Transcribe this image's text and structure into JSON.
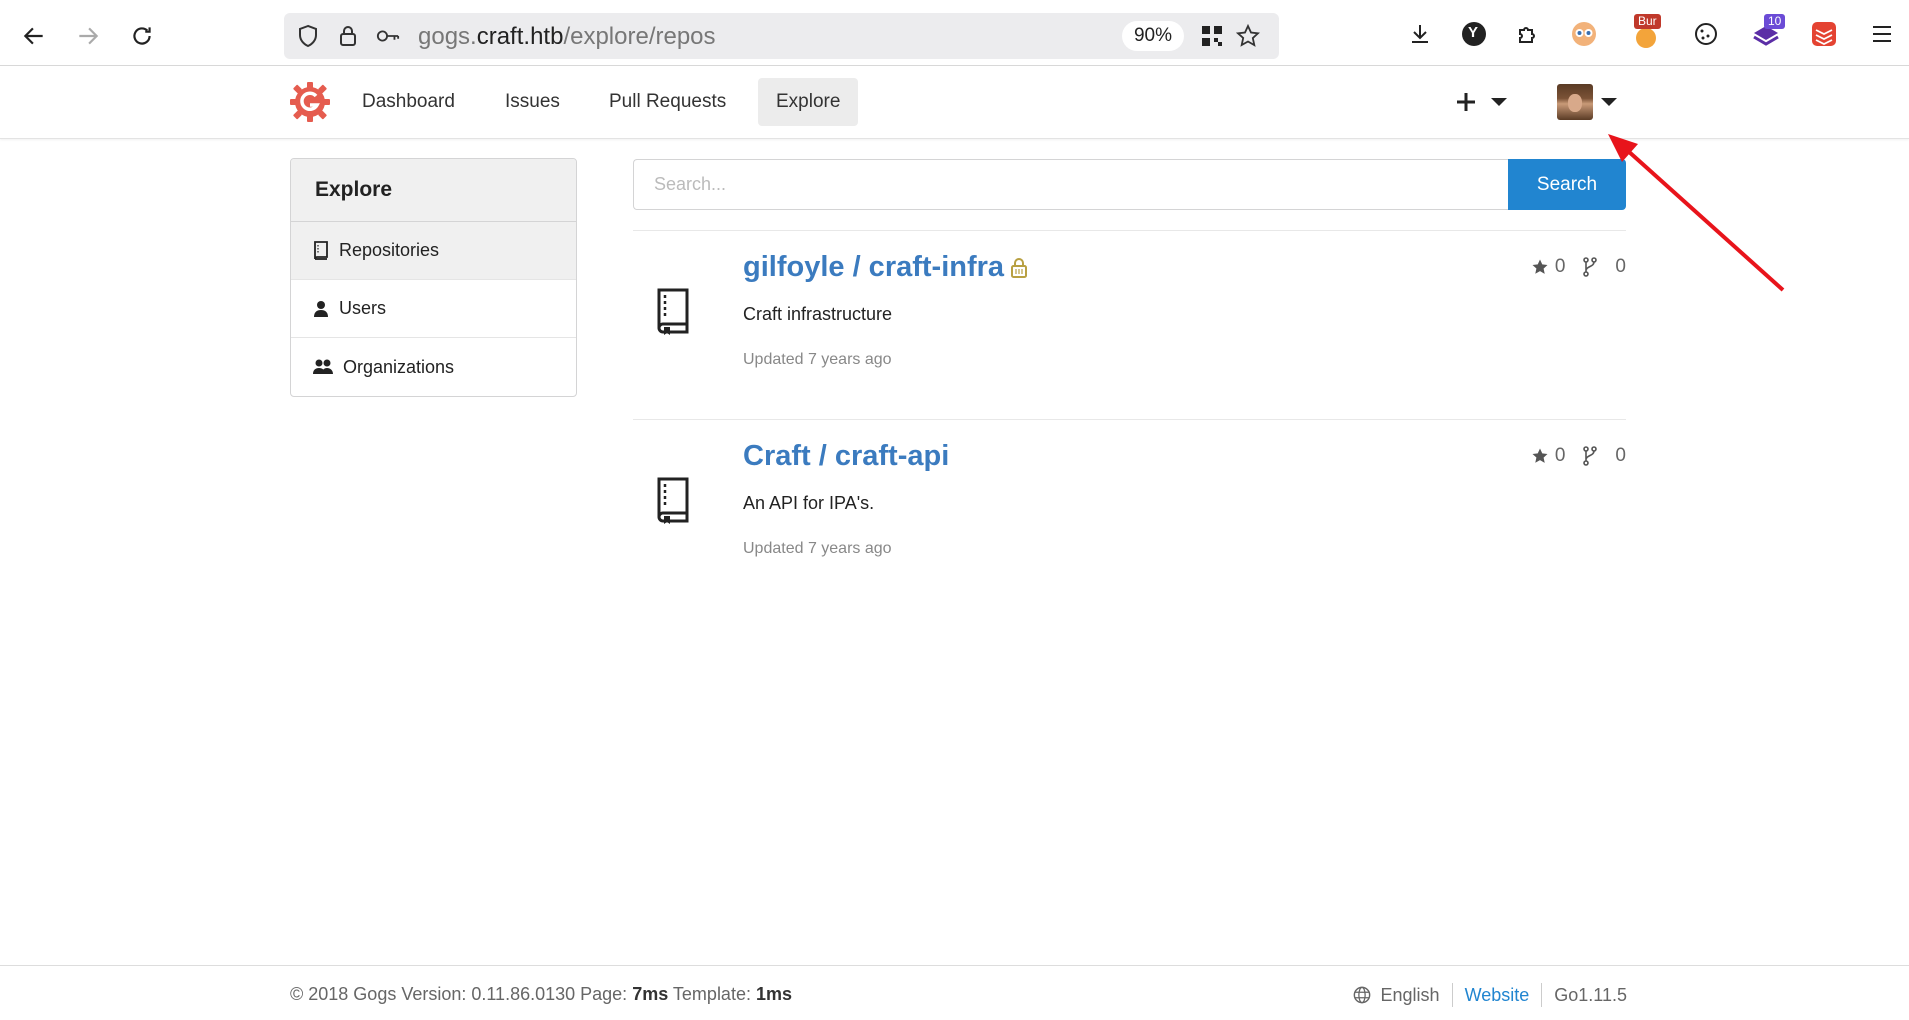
{
  "browser": {
    "url_prefix": "gogs.",
    "url_host": "craft.htb",
    "url_path": "/explore/repos",
    "zoom": "90%",
    "burp_badge": "Bur",
    "ext_count_badge": "10",
    "yandex_label": "Y"
  },
  "header": {
    "nav": [
      {
        "label": "Dashboard"
      },
      {
        "label": "Issues"
      },
      {
        "label": "Pull Requests"
      },
      {
        "label": "Explore"
      }
    ],
    "brand_color": "#e55c4f"
  },
  "sidebar": {
    "title": "Explore",
    "items": [
      {
        "label": "Repositories",
        "icon": "repo-icon",
        "active": true
      },
      {
        "label": "Users",
        "icon": "user-icon",
        "active": false
      },
      {
        "label": "Organizations",
        "icon": "organization-icon",
        "active": false
      }
    ]
  },
  "search": {
    "placeholder": "Search...",
    "button_label": "Search"
  },
  "repos": [
    {
      "title": "gilfoyle / craft-infra",
      "private": true,
      "description": "Craft infrastructure",
      "updated": "Updated 7 years ago",
      "stars": "0",
      "forks": "0"
    },
    {
      "title": "Craft / craft-api",
      "private": false,
      "description": "An API for IPA's.",
      "updated": "Updated 7 years ago",
      "stars": "0",
      "forks": "0"
    }
  ],
  "footer": {
    "copyright": "© 2018 Gogs Version: 0.11.86.0130 Page:",
    "page_time": "7ms",
    "template_label": "Template:",
    "template_time": "1ms",
    "language": "English",
    "website_label": "Website",
    "go_version": "Go1.11.5"
  },
  "colors": {
    "accent": "#2185d0",
    "link": "#3b7bbf",
    "annotation": "#e8141b"
  }
}
